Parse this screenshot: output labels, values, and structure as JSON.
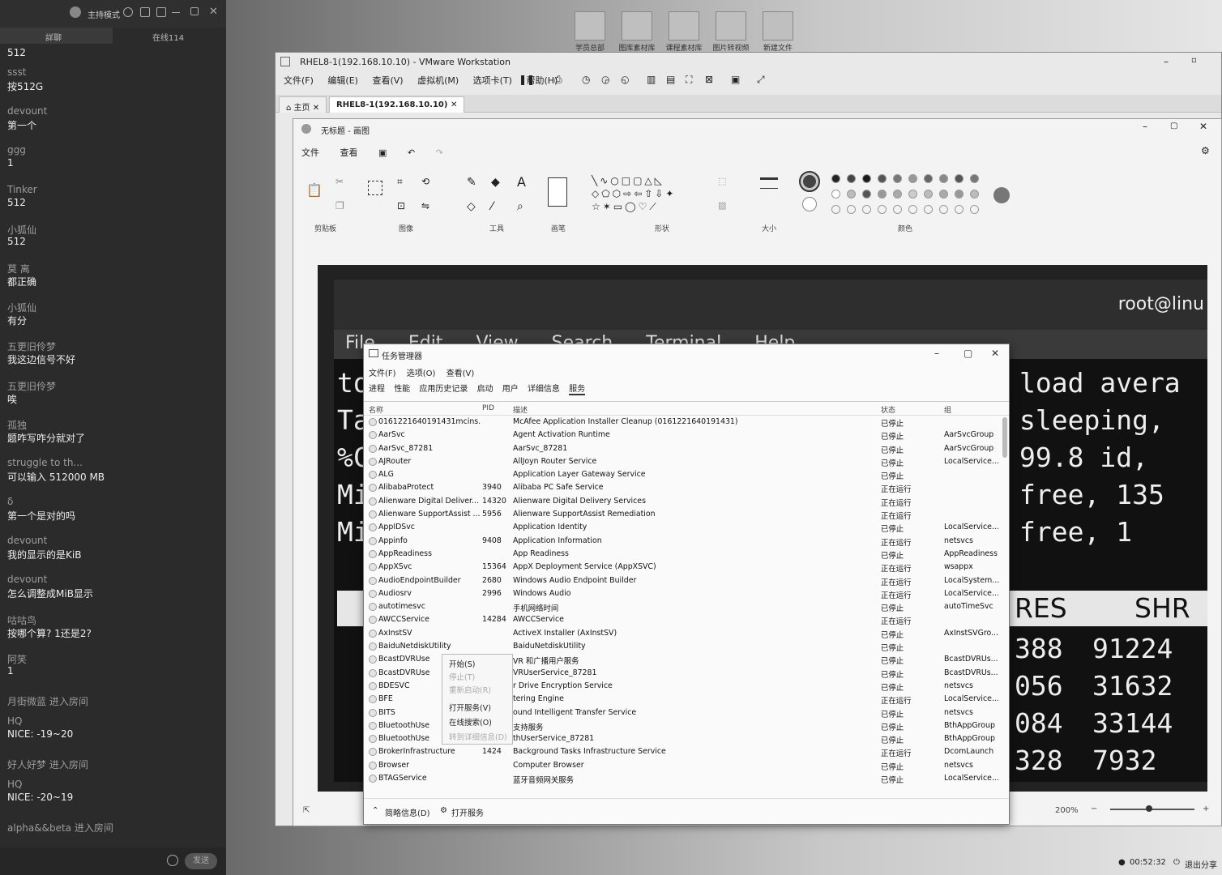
{
  "chat": {
    "mode": "主持模式",
    "tabs": [
      "詳聊",
      "在线114"
    ],
    "first_text": "512",
    "messages": [
      {
        "user": "ssst",
        "text": "按512G"
      },
      {
        "user": "devount",
        "text": "第一个"
      },
      {
        "user": "ggg",
        "text": "1"
      },
      {
        "user": "Tinker",
        "text": "512"
      },
      {
        "user": "小狐仙",
        "text": "512"
      },
      {
        "user": "莫 离",
        "text": "都正确"
      },
      {
        "user": "小狐仙",
        "text": "有分"
      },
      {
        "user": "五更旧伶梦",
        "text": "我这边信号不好"
      },
      {
        "user": "五更旧伶梦",
        "text": "唉"
      },
      {
        "user": "孤独",
        "text": "题咋写咋分就对了"
      },
      {
        "user": "struggle to th...",
        "text": "可以输入 512000 MB"
      },
      {
        "user": "δ",
        "text": "第一个是对的吗"
      },
      {
        "user": "devount",
        "text": "我的显示的是KiB"
      },
      {
        "user": "devount",
        "text": "怎么调整成MiB显示"
      },
      {
        "user": "咕咕鸟",
        "text": "按哪个算? 1还是2?"
      },
      {
        "user": "阿笑",
        "text": "1"
      }
    ],
    "tail": [
      {
        "sys": "月街微蓝 进入房间"
      },
      {
        "user": "HQ",
        "text": "NICE: -19~20"
      },
      {
        "sys": "好人好梦 进入房间"
      },
      {
        "user": "HQ",
        "text": "NICE: -20~19"
      },
      {
        "sys": "alpha&&beta 进入房间"
      }
    ],
    "send": "发送"
  },
  "desktop_icons": [
    "学员总部",
    "图库素材库",
    "课程素材库",
    "图片转视频",
    "新建文件"
  ],
  "vmware": {
    "title": "RHEL8-1(192.168.10.10) - VMware Workstation",
    "menu": [
      "文件(F)",
      "编辑(E)",
      "查看(V)",
      "虚拟机(M)",
      "选项卡(T)",
      "帮助(H)"
    ],
    "tabs": [
      "主页",
      "RHEL8-1(192.168.10.10)"
    ]
  },
  "paint": {
    "title": "无标题 - 画图",
    "menu": [
      "文件",
      "查看"
    ],
    "groups": [
      "剪贴板",
      "图像",
      "工具",
      "画笔",
      "形状",
      "大小",
      "颜色"
    ],
    "zoom": "200%",
    "terminal": {
      "user": "root@linu",
      "menu": [
        "File",
        "Edit",
        "View",
        "Search",
        "Terminal",
        "Help"
      ],
      "lines": [
        "to",
        "Ta",
        "%C",
        "Mi",
        "Mi"
      ],
      "right": [
        "load avera",
        "sleeping,",
        "99.8 id,",
        "free,     135",
        "free,      1"
      ],
      "cols": [
        "RES",
        "SHR"
      ],
      "res": [
        "388",
        "056",
        "084",
        "328"
      ],
      "shr": [
        "91224",
        "31632",
        "33144",
        "7932"
      ]
    }
  },
  "taskmgr": {
    "title": "任务管理器",
    "menu": [
      "文件(F)",
      "选项(O)",
      "查看(V)"
    ],
    "tabs": [
      "进程",
      "性能",
      "应用历史记录",
      "启动",
      "用户",
      "详细信息",
      "服务"
    ],
    "headers": [
      "名称",
      "PID",
      "描述",
      "状态",
      "组"
    ],
    "rows": [
      [
        "0161221640191431mcins...",
        "",
        "McAfee Application Installer Cleanup (0161221640191431)",
        "已停止",
        ""
      ],
      [
        "AarSvc",
        "",
        "Agent Activation Runtime",
        "已停止",
        "AarSvcGroup"
      ],
      [
        "AarSvc_87281",
        "",
        "AarSvc_87281",
        "已停止",
        "AarSvcGroup"
      ],
      [
        "AJRouter",
        "",
        "AllJoyn Router Service",
        "已停止",
        "LocalService..."
      ],
      [
        "ALG",
        "",
        "Application Layer Gateway Service",
        "已停止",
        ""
      ],
      [
        "AlibabaProtect",
        "3940",
        "Alibaba PC Safe Service",
        "正在运行",
        ""
      ],
      [
        "Alienware Digital Deliver...",
        "14320",
        "Alienware Digital Delivery Services",
        "正在运行",
        ""
      ],
      [
        "Alienware SupportAssist ...",
        "5956",
        "Alienware SupportAssist Remediation",
        "正在运行",
        ""
      ],
      [
        "AppIDSvc",
        "",
        "Application Identity",
        "已停止",
        "LocalService..."
      ],
      [
        "Appinfo",
        "9408",
        "Application Information",
        "正在运行",
        "netsvcs"
      ],
      [
        "AppReadiness",
        "",
        "App Readiness",
        "已停止",
        "AppReadiness"
      ],
      [
        "AppXSvc",
        "15364",
        "AppX Deployment Service (AppXSVC)",
        "正在运行",
        "wsappx"
      ],
      [
        "AudioEndpointBuilder",
        "2680",
        "Windows Audio Endpoint Builder",
        "正在运行",
        "LocalSystem..."
      ],
      [
        "Audiosrv",
        "2996",
        "Windows Audio",
        "正在运行",
        "LocalService..."
      ],
      [
        "autotimesvc",
        "",
        "手机网络时间",
        "已停止",
        "autoTimeSvc"
      ],
      [
        "AWCCService",
        "14284",
        "AWCCService",
        "正在运行",
        ""
      ],
      [
        "AxInstSV",
        "",
        "ActiveX Installer (AxInstSV)",
        "已停止",
        "AxInstSVGro..."
      ],
      [
        "BaiduNetdiskUtility",
        "",
        "BaiduNetdiskUtility",
        "已停止",
        ""
      ],
      [
        "BcastDVRUse",
        "",
        "VR 和广播用户服务",
        "已停止",
        "BcastDVRUs..."
      ],
      [
        "BcastDVRUse",
        "",
        "VRUserService_87281",
        "已停止",
        "BcastDVRUs..."
      ],
      [
        "BDESVC",
        "",
        "r Drive Encryption Service",
        "已停止",
        "netsvcs"
      ],
      [
        "BFE",
        "",
        "tering Engine",
        "正在运行",
        "LocalService..."
      ],
      [
        "BITS",
        "",
        "ound Intelligent Transfer Service",
        "已停止",
        "netsvcs"
      ],
      [
        "BluetoothUse",
        "",
        "支持服务",
        "已停止",
        "BthAppGroup"
      ],
      [
        "BluetoothUse",
        "",
        "thUserService_87281",
        "已停止",
        "BthAppGroup"
      ],
      [
        "BrokerInfrastructure",
        "1424",
        "Background Tasks Infrastructure Service",
        "正在运行",
        "DcomLaunch"
      ],
      [
        "Browser",
        "",
        "Computer Browser",
        "已停止",
        "netsvcs"
      ],
      [
        "BTAGService",
        "",
        "蓝牙音频网关服务",
        "已停止",
        "LocalService..."
      ]
    ],
    "context_menu": [
      "开始(S)",
      "停止(T)",
      "重新启动(R)",
      "打开服务(V)",
      "在线搜索(O)",
      "转到详细信息(D)"
    ],
    "footer": [
      "简略信息(D)",
      "打开服务"
    ]
  },
  "taskbar": {
    "time": "00:52:32",
    "exit": "退出分享"
  }
}
